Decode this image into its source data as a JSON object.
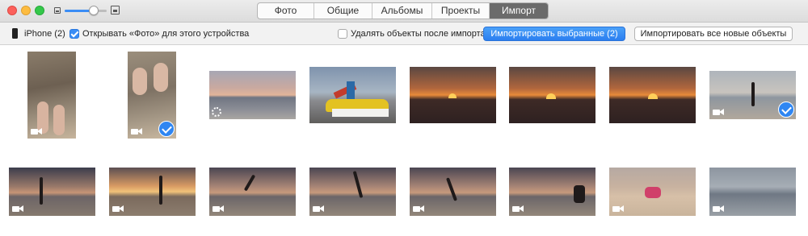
{
  "toolbar": {
    "zoom_level": 0.7,
    "tabs": [
      {
        "label": "Фото",
        "active": false
      },
      {
        "label": "Общие",
        "active": false
      },
      {
        "label": "Альбомы",
        "active": false
      },
      {
        "label": "Проекты",
        "active": false
      },
      {
        "label": "Импорт",
        "active": true
      }
    ]
  },
  "import_bar": {
    "device_label": "iPhone (2)",
    "open_photos_checkbox": {
      "label": "Открывать «Фото» для этого устройства",
      "checked": true
    },
    "delete_after_import_checkbox": {
      "label": "Удалять объекты после импорта",
      "checked": false
    },
    "import_selected_button": "Импортировать выбранные (2)",
    "import_all_new_button": "Импортировать все новые объекты"
  },
  "colors": {
    "accent": "#2f86f2",
    "active_tab": "#6b6b6b"
  },
  "photos": [
    {
      "kind": "video",
      "subject": "feet-on-pebbles",
      "selected": false,
      "loading": false
    },
    {
      "kind": "video",
      "subject": "feet-on-pebbles",
      "selected": true,
      "loading": false
    },
    {
      "kind": "photo",
      "subject": "sea-sunset",
      "selected": false,
      "loading": true
    },
    {
      "kind": "photo",
      "subject": "pedal-boat-with-slide",
      "selected": false,
      "loading": false
    },
    {
      "kind": "photo",
      "subject": "orange-sunset",
      "selected": false,
      "loading": false
    },
    {
      "kind": "photo",
      "subject": "orange-sunset",
      "selected": false,
      "loading": false
    },
    {
      "kind": "photo",
      "subject": "orange-sunset",
      "selected": false,
      "loading": false
    },
    {
      "kind": "video",
      "subject": "dancer-on-beach",
      "selected": true,
      "loading": false
    },
    {
      "kind": "video",
      "subject": "dancer-silhouette",
      "selected": false,
      "loading": false
    },
    {
      "kind": "video",
      "subject": "dancer-silhouette",
      "selected": false,
      "loading": false
    },
    {
      "kind": "video",
      "subject": "jumping-person",
      "selected": false,
      "loading": false
    },
    {
      "kind": "video",
      "subject": "jumping-person",
      "selected": false,
      "loading": false
    },
    {
      "kind": "video",
      "subject": "handstand",
      "selected": false,
      "loading": false
    },
    {
      "kind": "video",
      "subject": "crouching-person",
      "selected": false,
      "loading": false
    },
    {
      "kind": "video",
      "subject": "crouching-person",
      "selected": false,
      "loading": false
    },
    {
      "kind": "video",
      "subject": "sea-horizon",
      "selected": false,
      "loading": false
    }
  ]
}
